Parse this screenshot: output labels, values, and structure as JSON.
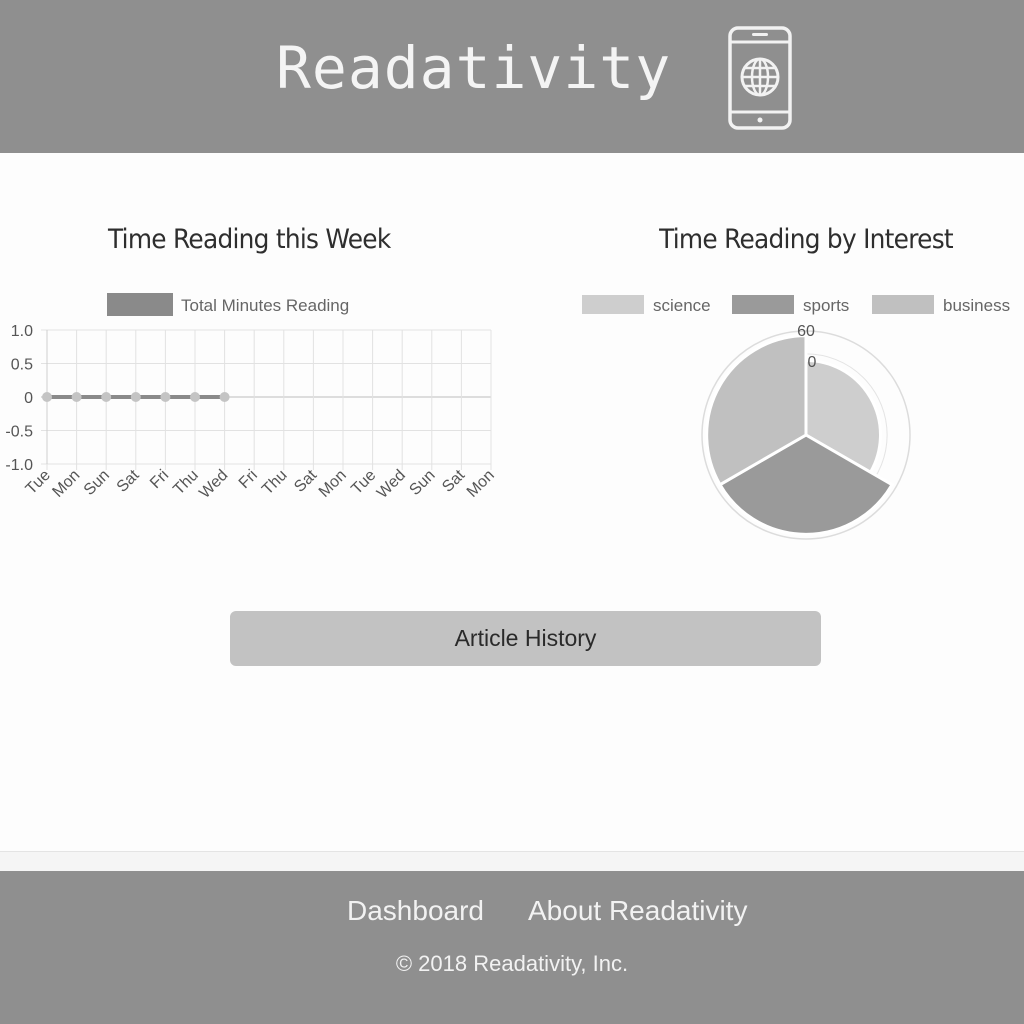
{
  "header": {
    "brand": "Readativity",
    "logo_icon": "mobile-globe-icon"
  },
  "charts": {
    "week_title": "Time Reading this Week",
    "interest_title": "Time Reading by Interest"
  },
  "chart_data": [
    {
      "type": "line",
      "title": "Time Reading this Week",
      "legend": [
        "Total Minutes Reading"
      ],
      "legend_position": "top",
      "categories": [
        "Tue",
        "Mon",
        "Sun",
        "Sat",
        "Fri",
        "Thu",
        "Wed",
        "Fri",
        "Thu",
        "Sat",
        "Mon",
        "Tue",
        "Wed",
        "Sun",
        "Sat",
        "Mon"
      ],
      "series": [
        {
          "name": "Total Minutes Reading",
          "values": [
            0,
            0,
            0,
            0,
            0,
            0,
            0
          ],
          "color": "#8a8a8a"
        }
      ],
      "ylim": [
        -1.0,
        1.0
      ],
      "yticks": [
        "1.0",
        "0.5",
        "0",
        "-0.5",
        "-1.0"
      ],
      "grid": true
    },
    {
      "type": "polar-area",
      "title": "Time Reading by Interest",
      "legend": [
        "science",
        "sports",
        "business"
      ],
      "legend_position": "top",
      "categories": [
        "science",
        "sports",
        "business"
      ],
      "values": [
        45,
        60,
        60
      ],
      "colors": [
        "#cecece",
        "#9a9a9a",
        "#c0c0c0"
      ],
      "ticks": [
        "60",
        "0"
      ],
      "rmax": 60
    }
  ],
  "actions": {
    "article_history": "Article History"
  },
  "footer": {
    "dashboard": "Dashboard",
    "about": "About Readativity",
    "copyright": "© 2018 Readativity, Inc."
  }
}
